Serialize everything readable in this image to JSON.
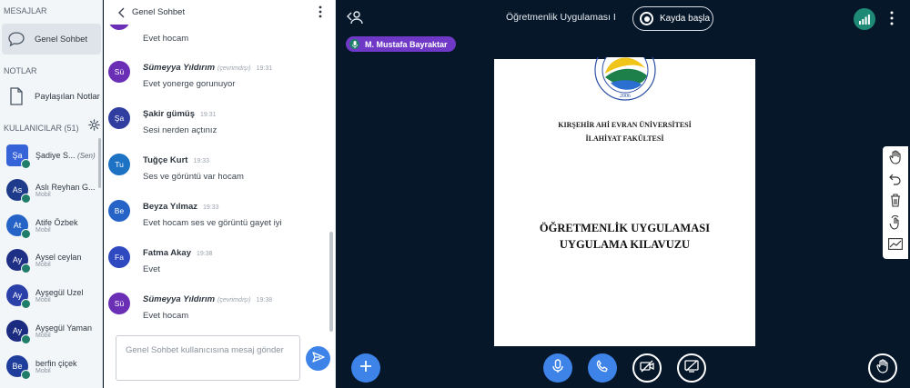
{
  "sidebar": {
    "messages_title": "MESAJLAR",
    "public_chat_label": "Genel Sohbet",
    "notes_title": "NOTLAR",
    "shared_notes_label": "Paylaşılan Notlar",
    "users_title": "KULLANICILAR (51)",
    "users": [
      {
        "initials": "Şa",
        "name": "Şadiye S...",
        "sub": "",
        "you": "(Sen)",
        "color": "#3763d8"
      },
      {
        "initials": "As",
        "name": "Aslı Reyhan G...",
        "sub": "Mobil",
        "you": "",
        "color": "#1e3a8a"
      },
      {
        "initials": "At",
        "name": "Atife Özbek",
        "sub": "Mobil",
        "you": "",
        "color": "#2563c7"
      },
      {
        "initials": "Ay",
        "name": "Aysel ceylan",
        "sub": "Mobil",
        "you": "",
        "color": "#1e2f86"
      },
      {
        "initials": "Ay",
        "name": "Ayşegül Uzel",
        "sub": "Mobil",
        "you": "",
        "color": "#2a3fa8"
      },
      {
        "initials": "Ay",
        "name": "Ayşegül Yaman",
        "sub": "Mobil",
        "you": "",
        "color": "#1b2c80"
      },
      {
        "initials": "Be",
        "name": "berfin çiçek",
        "sub": "Mobil",
        "you": "",
        "color": "#1f3d9a"
      }
    ]
  },
  "chat": {
    "title": "Genel Sohbet",
    "input_placeholder": "Genel Sohbet kullanıcısına mesaj gönder",
    "messages": [
      {
        "initials": "",
        "sender": "",
        "status": "",
        "time": "",
        "text": "Evet hocam",
        "color": "#6b2fb5"
      },
      {
        "initials": "Sü",
        "sender": "Sümeyya Yıldırım",
        "status": "(çevrimdışı)",
        "time": "19:31",
        "text": "Evet yonerge gorunuyor",
        "color": "#6b2fb5"
      },
      {
        "initials": "Şa",
        "sender": "Şakir gümüş",
        "status": "",
        "time": "19:31",
        "text": "Sesi nerden açtınız",
        "color": "#303f9f"
      },
      {
        "initials": "Tu",
        "sender": "Tuğçe Kurt",
        "status": "",
        "time": "19:33",
        "text": "Ses ve görüntü var hocam",
        "color": "#1e72c4"
      },
      {
        "initials": "Be",
        "sender": "Beyza Yılmaz",
        "status": "",
        "time": "19:33",
        "text": "Evet hocam ses ve görüntü gayet iyi",
        "color": "#2563c7"
      },
      {
        "initials": "Fa",
        "sender": "Fatma Akay",
        "status": "",
        "time": "19:38",
        "text": "Evet",
        "color": "#2f4ac0"
      },
      {
        "initials": "Sü",
        "sender": "Sümeyya Yıldırım",
        "status": "(çevrimdışı)",
        "time": "19:38",
        "text": "Evet hocam",
        "color": "#6b2fb5"
      }
    ]
  },
  "header": {
    "meeting_title": "Öğretmenlik Uygulaması I",
    "record_label": "Kayda başla"
  },
  "presenter": {
    "name": "M. Mustafa Bayraktar"
  },
  "slide": {
    "university": "KIRŞEHİR AHİ EVRAN ÜNİVERSİTESİ",
    "faculty": "İLAHİYAT FAKÜLTESİ",
    "title_line1": "ÖĞRETMENLİK UYGULAMASI",
    "title_line2": "UYGULAMA KILAVUZU",
    "seal_year": "2006"
  },
  "icons": {
    "toolbar": [
      "hand-icon",
      "undo-icon",
      "trash-icon",
      "multi-user-icon",
      "chart-icon"
    ],
    "bottom": [
      "plus-icon",
      "microphone-icon",
      "phone-icon",
      "video-off-icon",
      "screen-share-off-icon",
      "raise-hand-icon"
    ]
  }
}
